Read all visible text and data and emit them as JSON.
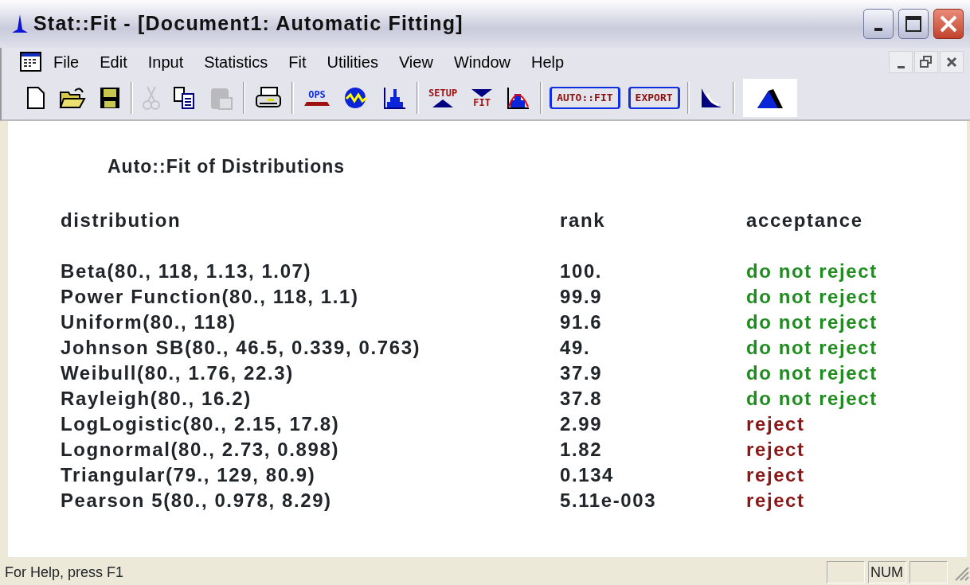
{
  "window": {
    "title": "Stat::Fit - [Document1: Automatic Fitting]"
  },
  "menu": [
    "File",
    "Edit",
    "Input",
    "Statistics",
    "Fit",
    "Utilities",
    "View",
    "Window",
    "Help"
  ],
  "toolbar": [
    {
      "kind": "new",
      "disabled": false
    },
    {
      "kind": "open",
      "disabled": false
    },
    {
      "kind": "save",
      "disabled": false
    },
    {
      "kind": "separator"
    },
    {
      "kind": "cut",
      "disabled": true
    },
    {
      "kind": "copy",
      "disabled": false
    },
    {
      "kind": "paste",
      "disabled": true
    },
    {
      "kind": "separator"
    },
    {
      "kind": "print",
      "disabled": false
    },
    {
      "kind": "separator"
    },
    {
      "kind": "ops",
      "label": "OPS",
      "disabled": false
    },
    {
      "kind": "wave",
      "disabled": false
    },
    {
      "kind": "histogram",
      "disabled": false
    },
    {
      "kind": "separator"
    },
    {
      "kind": "setup",
      "label": "SETUP",
      "disabled": false
    },
    {
      "kind": "fit",
      "label": "FIT",
      "disabled": false
    },
    {
      "kind": "fitplot",
      "disabled": false
    },
    {
      "kind": "separator"
    },
    {
      "kind": "textbutton",
      "label": "AUTO::FIT",
      "disabled": false
    },
    {
      "kind": "textbutton",
      "label": "EXPORT",
      "disabled": false
    },
    {
      "kind": "separator"
    },
    {
      "kind": "decay",
      "disabled": false
    },
    {
      "kind": "separator"
    },
    {
      "kind": "distribution",
      "disabled": false
    }
  ],
  "report": {
    "title": "Auto::Fit of Distributions",
    "columns": [
      "distribution",
      "rank",
      "acceptance"
    ],
    "rows": [
      {
        "distribution": "Beta(80., 118, 1.13, 1.07)",
        "rank": "100.",
        "acceptance": "do not reject",
        "accepted": true
      },
      {
        "distribution": "Power Function(80., 118, 1.1)",
        "rank": "99.9",
        "acceptance": "do not reject",
        "accepted": true
      },
      {
        "distribution": "Uniform(80., 118)",
        "rank": "91.6",
        "acceptance": "do not reject",
        "accepted": true
      },
      {
        "distribution": "Johnson SB(80., 46.5, 0.339, 0.763)",
        "rank": "49.",
        "acceptance": "do not reject",
        "accepted": true
      },
      {
        "distribution": "Weibull(80., 1.76, 22.3)",
        "rank": "37.9",
        "acceptance": "do not reject",
        "accepted": true
      },
      {
        "distribution": "Rayleigh(80., 16.2)",
        "rank": "37.8",
        "acceptance": "do not reject",
        "accepted": true
      },
      {
        "distribution": "LogLogistic(80., 2.15, 17.8)",
        "rank": "2.99",
        "acceptance": "reject",
        "accepted": false
      },
      {
        "distribution": "Lognormal(80., 2.73, 0.898)",
        "rank": "1.82",
        "acceptance": "reject",
        "accepted": false
      },
      {
        "distribution": "Triangular(79., 129, 80.9)",
        "rank": "0.134",
        "acceptance": "reject",
        "accepted": false
      },
      {
        "distribution": "Pearson 5(80., 0.978, 8.29)",
        "rank": "5.11e-003",
        "acceptance": "reject",
        "accepted": false
      }
    ]
  },
  "status_bar": {
    "message": "For Help, press F1",
    "num_indicator": "NUM"
  }
}
